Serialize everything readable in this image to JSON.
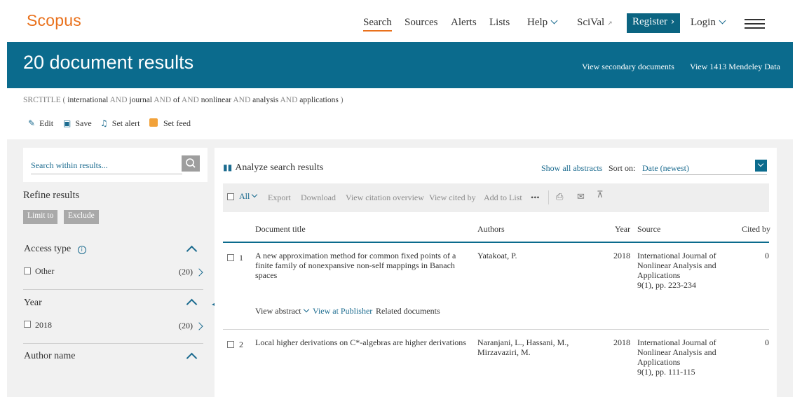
{
  "brand": {
    "logo_text": "Scopus",
    "accent": "#e9711c",
    "primary": "#0b6b8d"
  },
  "nav": {
    "search": "Search",
    "sources": "Sources",
    "alerts": "Alerts",
    "lists": "Lists",
    "help": "Help",
    "scival": "SciVal",
    "register": "Register",
    "login": "Login"
  },
  "banner": {
    "title": "20 document results",
    "secondary": "View secondary documents",
    "mendeley": "View 1413 Mendeley Data"
  },
  "query": {
    "prefix": "SRCTITLE (",
    "terms": [
      "international",
      "journal",
      "of",
      "nonlinear",
      "analysis",
      "applications"
    ],
    "op": "AND",
    "suffix": ")"
  },
  "actions": {
    "edit": "Edit",
    "save": "Save",
    "set_alert": "Set alert",
    "set_feed": "Set feed"
  },
  "sidebar": {
    "search_placeholder": "Search within results...",
    "refine_title": "Refine results",
    "limit_to": "Limit to",
    "exclude": "Exclude",
    "facets": [
      {
        "title": "Access type",
        "items": [
          {
            "label": "Other",
            "count": "(20)"
          }
        ]
      },
      {
        "title": "Year",
        "items": [
          {
            "label": "2018",
            "count": "(20)"
          }
        ]
      },
      {
        "title": "Author name",
        "items": []
      }
    ]
  },
  "results": {
    "analyze": "Analyze search results",
    "show_all_abstracts": "Show all abstracts",
    "sort_label": "Sort on:",
    "sort_value": "Date (newest)",
    "toolbar": {
      "all": "All",
      "export": "Export",
      "download": "Download",
      "citation_overview": "View citation overview",
      "cited_by": "View cited by",
      "add_to_list": "Add to List",
      "more": "•••"
    },
    "columns": {
      "title": "Document title",
      "authors": "Authors",
      "year": "Year",
      "source": "Source",
      "cited_by": "Cited by"
    },
    "rows": [
      {
        "num": "1",
        "title": "A new approximation method for common fixed points of a finite family of nonexpansive non-self mappings in Banach spaces",
        "authors": "Yatakoat, P.",
        "year": "2018",
        "source": "International Journal of Nonlinear Analysis and Applications",
        "source_detail": "9(1), pp. 223-234",
        "cited": "0",
        "view_abstract": "View abstract",
        "view_publisher": "View at Publisher",
        "related": "Related documents"
      },
      {
        "num": "2",
        "title": "Local higher derivations on C*-algebras are higher derivations",
        "authors": "Naranjani, L., Hassani, M., Mirzavaziri, M.",
        "year": "2018",
        "source": "International Journal of Nonlinear Analysis and Applications",
        "source_detail": "9(1), pp. 111-115",
        "cited": "0"
      }
    ]
  }
}
